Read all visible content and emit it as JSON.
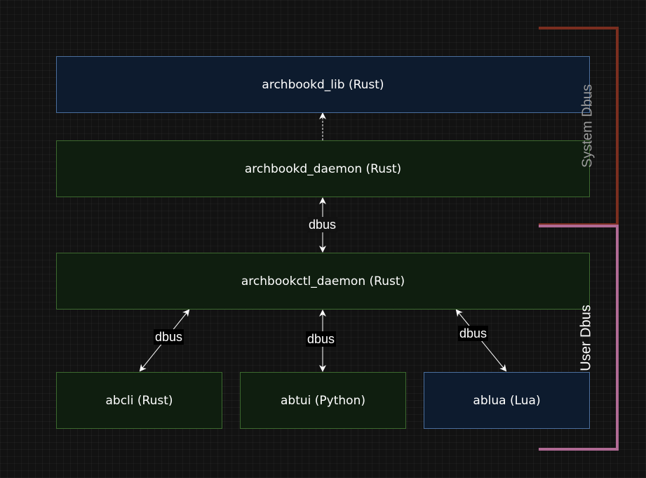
{
  "nodes": {
    "lib": {
      "label": "archbookd_lib (Rust)"
    },
    "daemon": {
      "label": "archbookd_daemon (Rust)"
    },
    "ctl_daemon": {
      "label": "archbookctl_daemon (Rust)"
    },
    "abcli": {
      "label": "abcli (Rust)"
    },
    "abtui": {
      "label": "abtui (Python)"
    },
    "ablua": {
      "label": "ablua (Lua)"
    }
  },
  "edges": {
    "daemon_ctl": {
      "label": "dbus"
    },
    "ctl_abcli": {
      "label": "dbus"
    },
    "ctl_abtui": {
      "label": "dbus"
    },
    "ctl_ablua": {
      "label": "dbus"
    }
  },
  "groups": {
    "system": {
      "label": "System Dbus",
      "color": "#7a2e1f"
    },
    "user": {
      "label": "User Dbus",
      "color": "#b06a94"
    }
  },
  "colors": {
    "background": "#121212",
    "blue_fill": "#0d1b2e",
    "blue_stroke": "#4b6f9d",
    "green_fill": "#0f1e0f",
    "green_stroke": "#3d6a2f",
    "system_label": "#9a9a9a",
    "user_label": "#ffffff"
  }
}
